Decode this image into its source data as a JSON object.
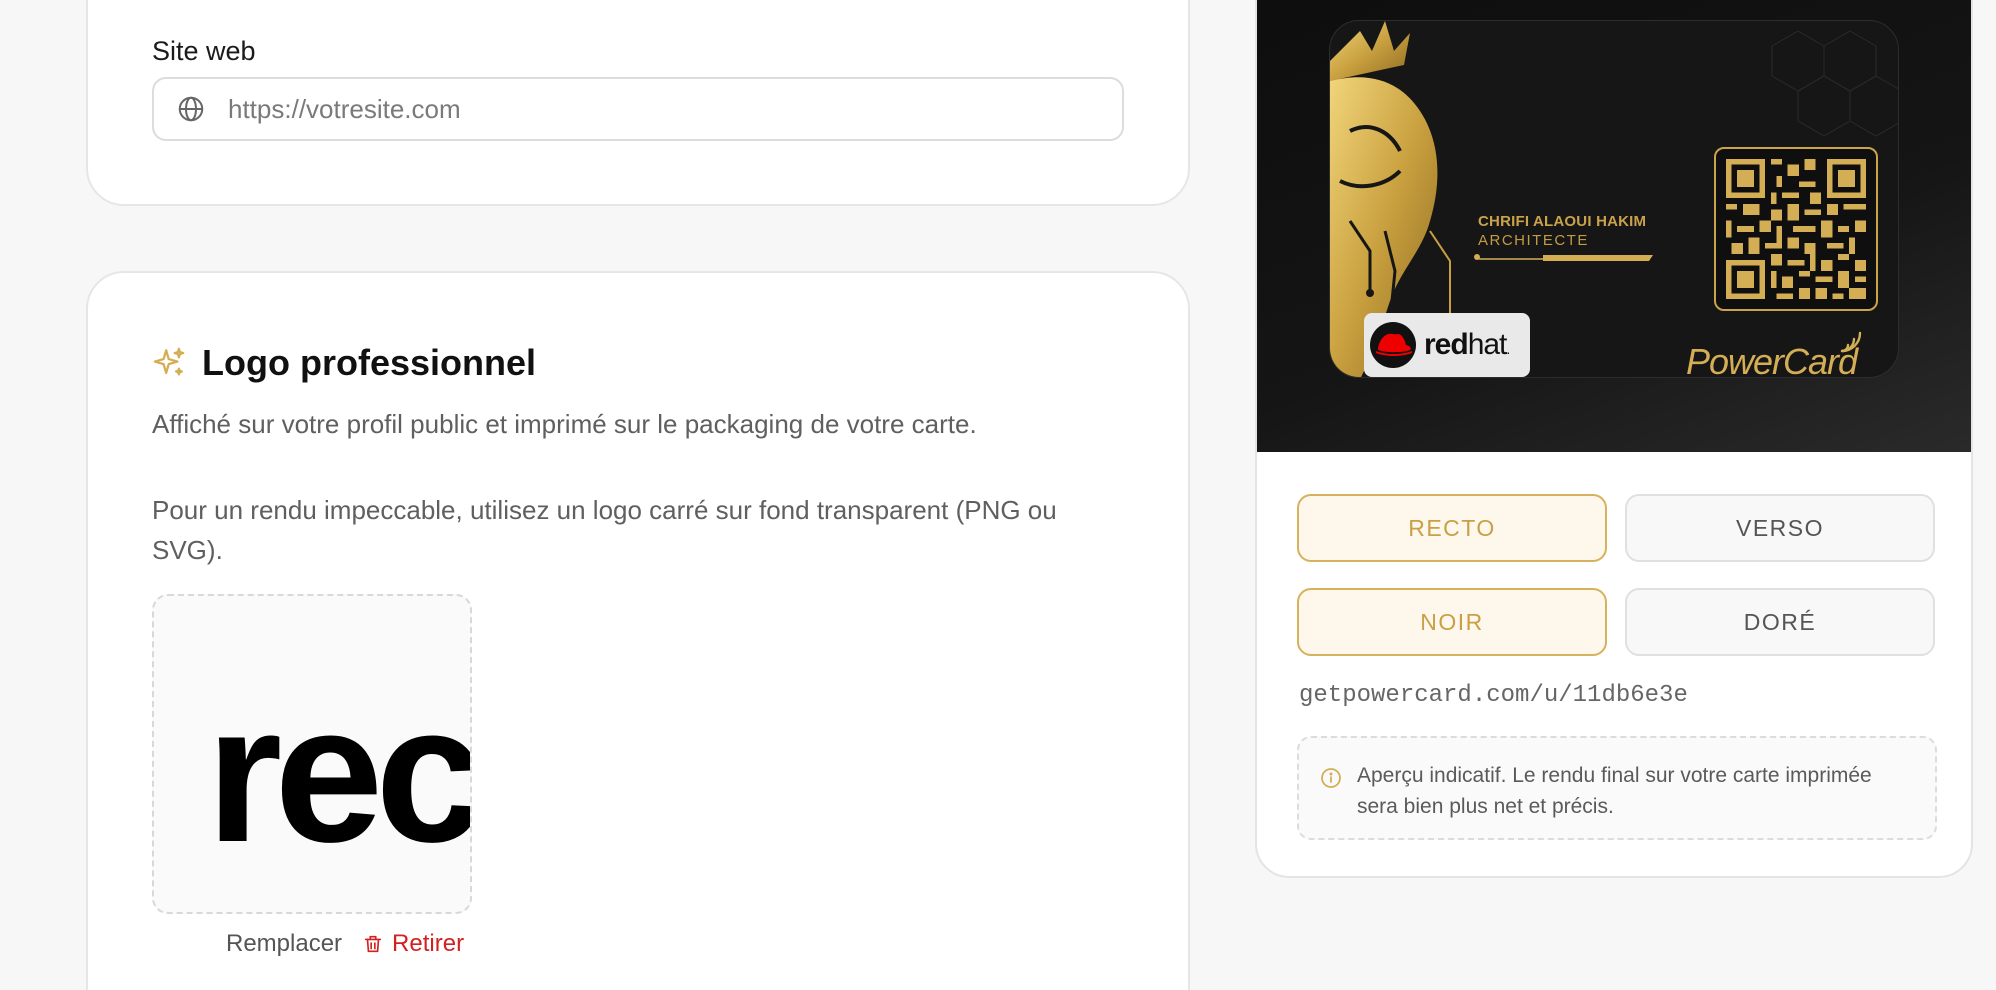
{
  "website": {
    "label": "Site web",
    "placeholder": "https://votresite.com",
    "value": ""
  },
  "logo_section": {
    "title": "Logo professionnel",
    "description": "Affiché sur votre profil public et imprimé sur le packaging de votre carte.",
    "tip": "Pour un rendu impeccable, utilisez un logo carré sur fond transparent (PNG ou SVG).",
    "preview_text": "rec",
    "replace_label": "Remplacer",
    "remove_label": "Retirer"
  },
  "card_preview": {
    "name": "CHRIFI ALAOUI HAKIM",
    "role": "ARCHITECTE",
    "company_logo": {
      "bold": "red",
      "regular": "hat",
      "suffix": "."
    },
    "brand": "PowerCard"
  },
  "controls": {
    "side": [
      {
        "label": "RECTO",
        "active": true
      },
      {
        "label": "VERSO",
        "active": false
      }
    ],
    "finish": [
      {
        "label": "NOIR",
        "active": true
      },
      {
        "label": "DORÉ",
        "active": false
      }
    ]
  },
  "profile_url": "getpowercard.com/u/11db6e3e",
  "notice": "Aperçu indicatif. Le rendu final sur votre carte imprimée sera bien plus net et précis.",
  "colors": {
    "gold": "#d4ae55",
    "danger": "#d42020",
    "card_bg": "#161616"
  }
}
